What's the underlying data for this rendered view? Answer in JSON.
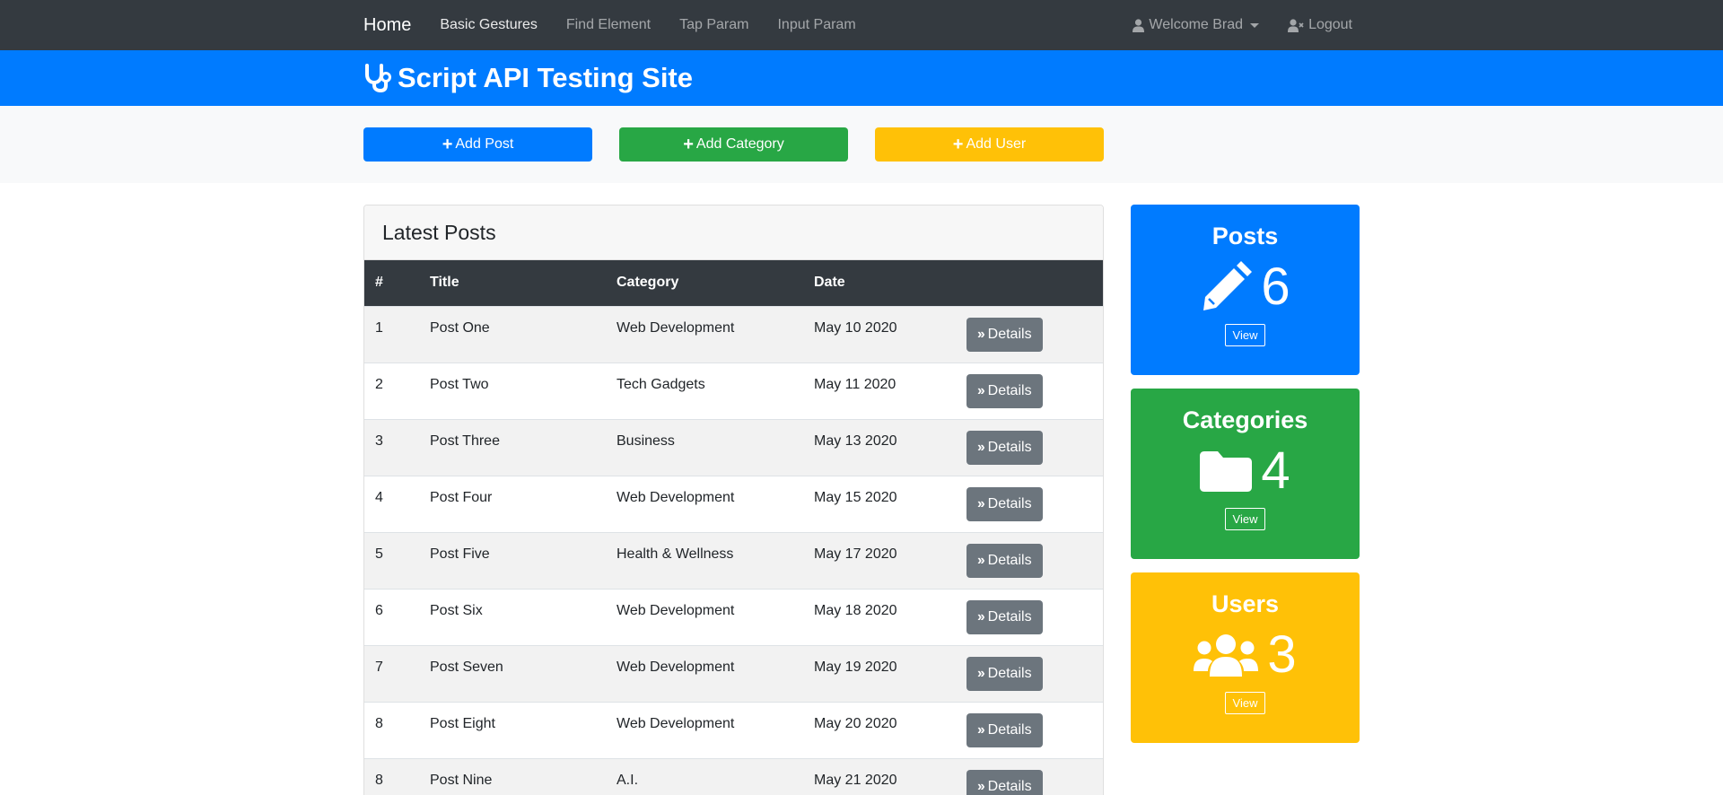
{
  "navbar": {
    "brand": "Home",
    "links": [
      "Basic Gestures",
      "Find Element",
      "Tap Param",
      "Input Param"
    ],
    "user_menu": "Welcome Brad",
    "logout": "Logout"
  },
  "header": {
    "title": "Script API Testing Site"
  },
  "actions": {
    "add_post": "Add Post",
    "add_category": "Add Category",
    "add_user": "Add User"
  },
  "posts": {
    "title": "Latest Posts",
    "columns": [
      "#",
      "Title",
      "Category",
      "Date"
    ],
    "details_label": "Details",
    "rows": [
      {
        "num": "1",
        "title": "Post One",
        "category": "Web Development",
        "date": "May 10 2020"
      },
      {
        "num": "2",
        "title": "Post Two",
        "category": "Tech Gadgets",
        "date": "May 11 2020"
      },
      {
        "num": "3",
        "title": "Post Three",
        "category": "Business",
        "date": "May 13 2020"
      },
      {
        "num": "4",
        "title": "Post Four",
        "category": "Web Development",
        "date": "May 15 2020"
      },
      {
        "num": "5",
        "title": "Post Five",
        "category": "Health & Wellness",
        "date": "May 17 2020"
      },
      {
        "num": "6",
        "title": "Post Six",
        "category": "Web Development",
        "date": "May 18 2020"
      },
      {
        "num": "7",
        "title": "Post Seven",
        "category": "Web Development",
        "date": "May 19 2020"
      },
      {
        "num": "8",
        "title": "Post Eight",
        "category": "Web Development",
        "date": "May 20 2020"
      },
      {
        "num": "8",
        "title": "Post Nine",
        "category": "A.I.",
        "date": "May 21 2020"
      }
    ]
  },
  "stats": {
    "posts": {
      "label": "Posts",
      "count": "6",
      "view": "View"
    },
    "categories": {
      "label": "Categories",
      "count": "4",
      "view": "View"
    },
    "users": {
      "label": "Users",
      "count": "3",
      "view": "View"
    }
  },
  "colors": {
    "primary": "#007bff",
    "success": "#28a745",
    "warning": "#ffc107",
    "dark": "#343a40",
    "secondary": "#6c757d"
  }
}
